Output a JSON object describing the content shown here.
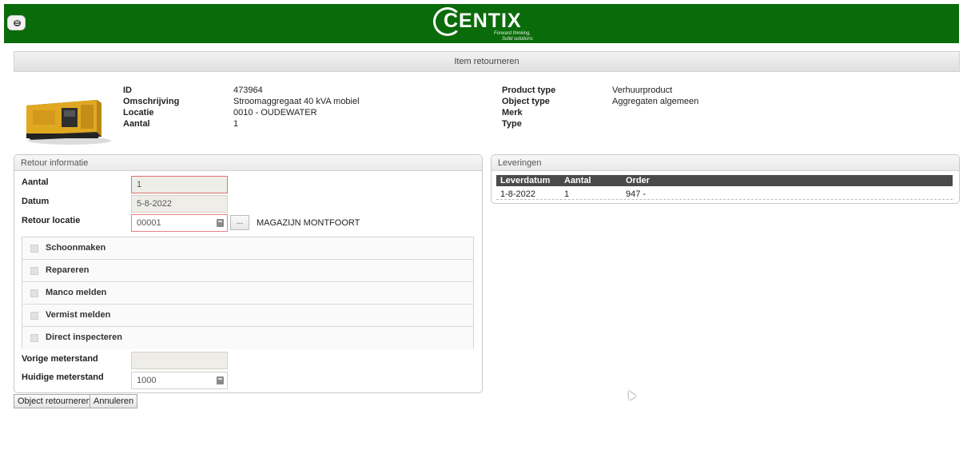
{
  "header": {
    "brand": "CENTIX",
    "tagline_1": "Forward thinking,",
    "tagline_2": "Solid solutions",
    "color": "#0a6b0a",
    "menu_icon": "menu-icon"
  },
  "page": {
    "title": "Item retourneren"
  },
  "item": {
    "image": "generator-image",
    "fields": [
      {
        "label": "ID",
        "value": "473964"
      },
      {
        "label": "Omschrijving",
        "value": "Stroomaggregaat 40 kVA mobiel"
      },
      {
        "label": "Locatie",
        "value": "0010 - OUDEWATER"
      },
      {
        "label": "Aantal",
        "value": "1"
      }
    ],
    "fields_right": [
      {
        "label": "Product type",
        "value": "Verhuurproduct"
      },
      {
        "label": "Object type",
        "value": "Aggregaten algemeen"
      },
      {
        "label": "Merk",
        "value": ""
      },
      {
        "label": "Type",
        "value": ""
      }
    ]
  },
  "retour": {
    "title": "Retour informatie",
    "aantal_label": "Aantal",
    "aantal_value": "1",
    "datum_label": "Datum",
    "datum_value": "5-8-2022",
    "locatie_label": "Retour locatie",
    "locatie_value": "00001",
    "locatie_btn": "...",
    "locatie_name": "MAGAZIJN MONTFOORT",
    "options": [
      "Schoonmaken",
      "Repareren",
      "Manco melden",
      "Vermist melden",
      "Direct inspecteren"
    ],
    "vorige_label": "Vorige meterstand",
    "vorige_value": "",
    "huidige_label": "Huidige meterstand",
    "huidige_value": "1000"
  },
  "actions": {
    "submit": "Object retourneren",
    "cancel": "Annuleren"
  },
  "leveringen": {
    "title": "Leveringen",
    "columns": [
      "Leverdatum",
      "Aantal",
      "Order"
    ],
    "rows": [
      [
        "1-8-2022",
        "1",
        "947 -"
      ]
    ]
  }
}
